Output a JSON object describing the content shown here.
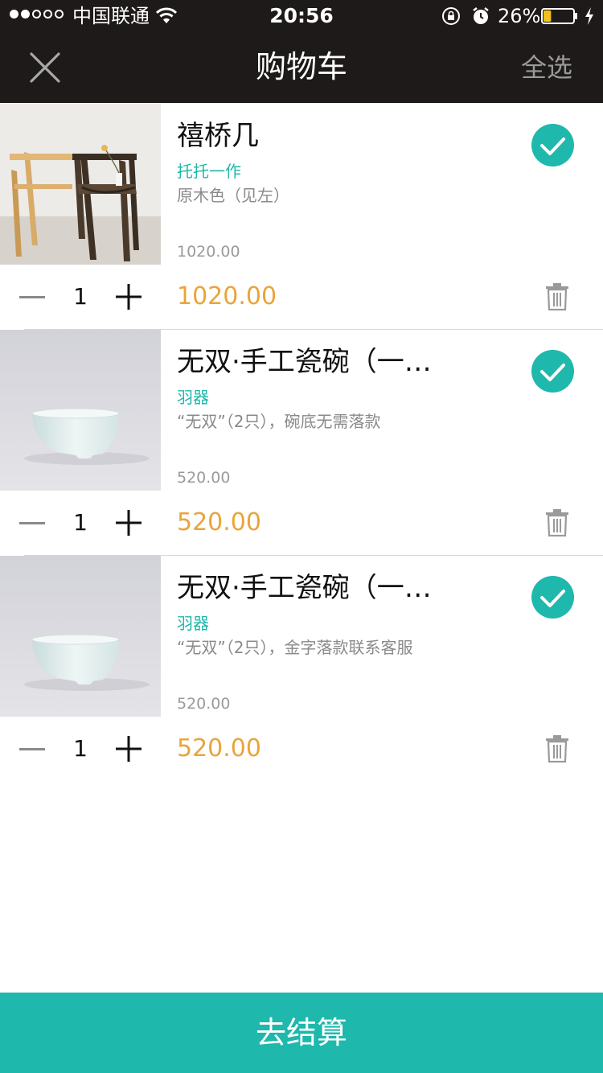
{
  "status_bar": {
    "carrier": "中国联通",
    "time": "20:56",
    "battery_percent": "26%",
    "battery_level": 0.26,
    "signal_bars_filled": 2,
    "signal_bars_total": 5,
    "icons": [
      "wifi-icon",
      "rotation-lock-icon",
      "alarm-icon",
      "battery-icon",
      "charging-icon"
    ]
  },
  "nav": {
    "close_icon": "close-icon",
    "title": "购物车",
    "select_all": "全选"
  },
  "items": [
    {
      "name": "禧桥几",
      "maker": "托托一作",
      "spec": "原木色（见左）",
      "unit_price": "1020.00",
      "quantity": "1",
      "line_total": "1020.00",
      "selected": true,
      "image": "wooden-side-table"
    },
    {
      "name": "无双·手工瓷碗（一…",
      "maker": "羽器",
      "spec": "“无双”（2只），碗底无需落款",
      "unit_price": "520.00",
      "quantity": "1",
      "line_total": "520.00",
      "selected": true,
      "image": "white-porcelain-bowl"
    },
    {
      "name": "无双·手工瓷碗（一…",
      "maker": "羽器",
      "spec": "“无双”（2只），金字落款联系客服",
      "unit_price": "520.00",
      "quantity": "1",
      "line_total": "520.00",
      "selected": true,
      "image": "white-porcelain-bowl"
    }
  ],
  "checkout": {
    "label": "去结算"
  },
  "colors": {
    "accent": "#1fb8ac",
    "price": "#eaa43a",
    "header_bg": "#1d1a19",
    "maker": "#1fb8aa"
  }
}
